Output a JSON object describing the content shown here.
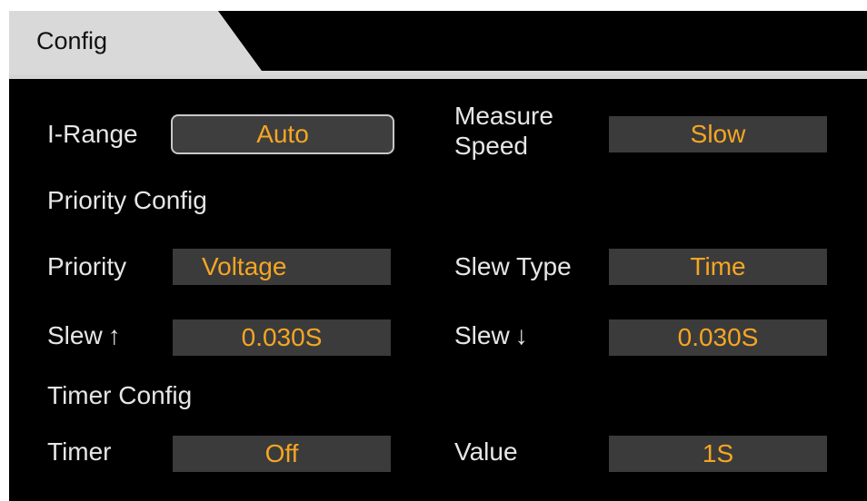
{
  "tab": {
    "label": "Config"
  },
  "colors": {
    "background": "#000000",
    "value_text": "#f5a623",
    "value_box": "#3b3b3b",
    "tab_bg": "#d9d9d9"
  },
  "fields": {
    "i_range": {
      "label": "I-Range",
      "value": "Auto"
    },
    "measure_speed": {
      "label_line1": "Measure",
      "label_line2": "Speed",
      "value": "Slow"
    },
    "priority_section": "Priority Config",
    "priority": {
      "label": "Priority",
      "value": "Voltage"
    },
    "slew_type": {
      "label": "Slew Type",
      "value": "Time"
    },
    "slew_up": {
      "label": "Slew",
      "arrow": "↑",
      "value": "0.030S"
    },
    "slew_down": {
      "label": "Slew",
      "arrow": "↓",
      "value": "0.030S"
    },
    "timer_section": "Timer Config",
    "timer": {
      "label": "Timer",
      "value": "Off"
    },
    "value": {
      "label": "Value",
      "value": "1S"
    }
  }
}
